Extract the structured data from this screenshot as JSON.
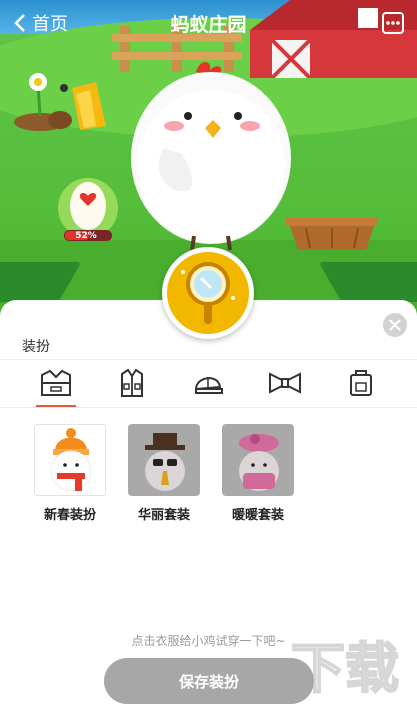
{
  "header": {
    "back_label": "首页",
    "title": "蚂蚁庄园"
  },
  "egg": {
    "progress_text": "52%",
    "progress_fraction": 0.52
  },
  "panel": {
    "title": "装扮",
    "tabs": [
      {
        "icon": "clothes-icon",
        "active": true
      },
      {
        "icon": "jacket-icon",
        "active": false
      },
      {
        "icon": "cap-icon",
        "active": false
      },
      {
        "icon": "bowtie-icon",
        "active": false
      },
      {
        "icon": "bag-icon",
        "active": false
      }
    ],
    "items": [
      {
        "label": "新春装扮",
        "owned": true
      },
      {
        "label": "华丽套装",
        "owned": false
      },
      {
        "label": "暖暖套装",
        "owned": false
      }
    ],
    "hint": "点击衣服给小鸡试穿一下吧~",
    "save_label": "保存装扮"
  },
  "colors": {
    "accent": "#e8583c",
    "grass": "#55be3a",
    "mirror": "#f2b800",
    "save_disabled": "#a7a7a7"
  }
}
